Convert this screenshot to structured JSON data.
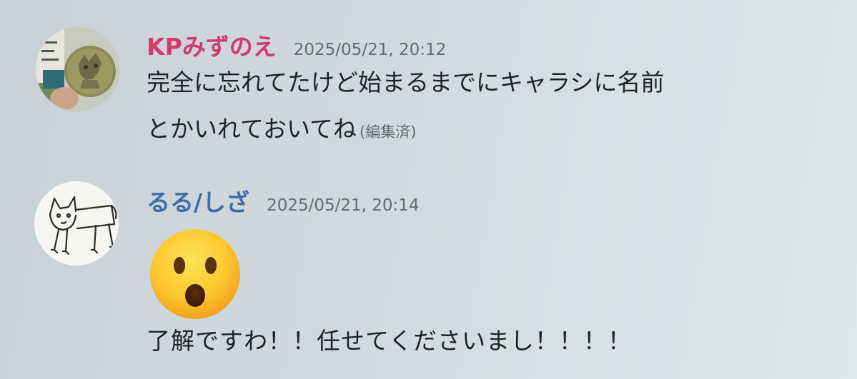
{
  "messages": [
    {
      "username": "KPみずのえ",
      "timestamp": "2025/05/21, 20:12",
      "lines": [
        "完全に忘れてたけど始まるまでにキャラシに名前",
        "とかいれておいてね"
      ],
      "edited_label": "(編集済)",
      "avatar": "cookie-photo-avatar",
      "name_color": "#d33a6a"
    },
    {
      "username": "るる/しざ",
      "timestamp": "2025/05/21, 20:14",
      "emoji": "hushed-face-emoji",
      "text": "了解ですわ！！任せてくださいまし！！！！",
      "avatar": "cat-drawing-avatar",
      "name_color": "#3d6ea8"
    }
  ]
}
